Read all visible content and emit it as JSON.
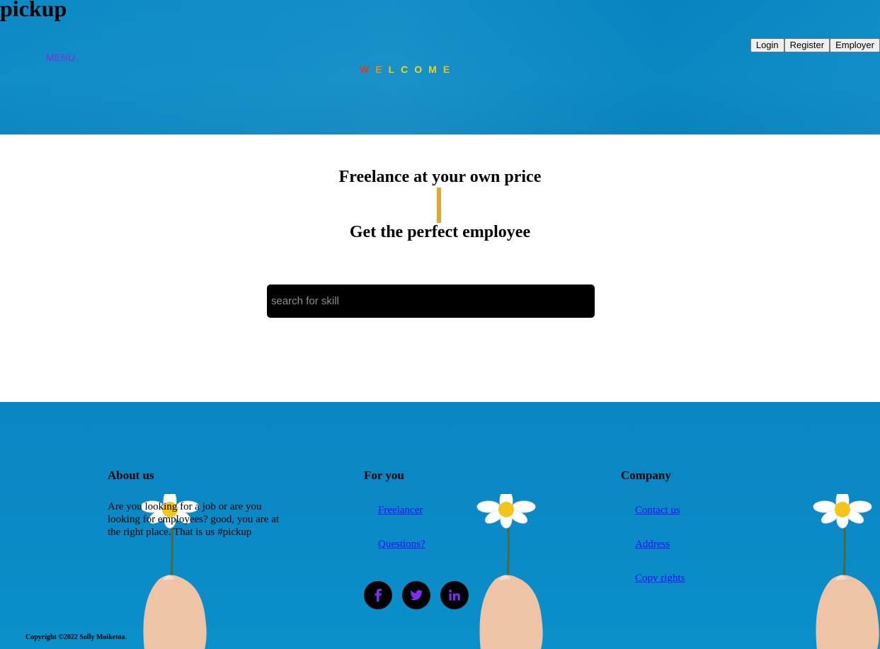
{
  "header": {
    "logo": "pickup",
    "menu_label": "MENU",
    "welcome_letters": [
      {
        "char": "W",
        "color": "#e03a1e"
      },
      {
        "char": "E",
        "color": "#f08a1a"
      },
      {
        "char": "L",
        "color": "#f5c518"
      },
      {
        "char": "C",
        "color": "#f5d90f"
      },
      {
        "char": "O",
        "color": "#f5d90f"
      },
      {
        "char": "M",
        "color": "#f3cf16"
      },
      {
        "char": "E",
        "color": "#f0c018"
      }
    ],
    "buttons": {
      "login": "Login",
      "register": "Register",
      "employer": "Employer"
    }
  },
  "main": {
    "headline_1": "Freelance at your own price",
    "headline_2": "Get the perfect employee",
    "divider_color": "#e0a72c",
    "search": {
      "placeholder": "search for skill",
      "value": ""
    }
  },
  "footer": {
    "about": {
      "title": "About us",
      "text": "Are you looking for a job or are you looking for employees? good, you are at the right place. That is us #pickup"
    },
    "for_you": {
      "title": "For you",
      "links": [
        "Freelancer",
        "Questions?"
      ],
      "social": [
        {
          "icon": "facebook-icon",
          "glyph": "f"
        },
        {
          "icon": "twitter-icon",
          "glyph": "t"
        },
        {
          "icon": "linkedin-icon",
          "glyph": "in"
        }
      ]
    },
    "company": {
      "title": "Company",
      "links": [
        "Contact us",
        "Address",
        "Copy rights"
      ]
    },
    "copyright": "Copyright ©2022 Solly Moiketoa.",
    "accent_color": "#7b2ff7"
  }
}
